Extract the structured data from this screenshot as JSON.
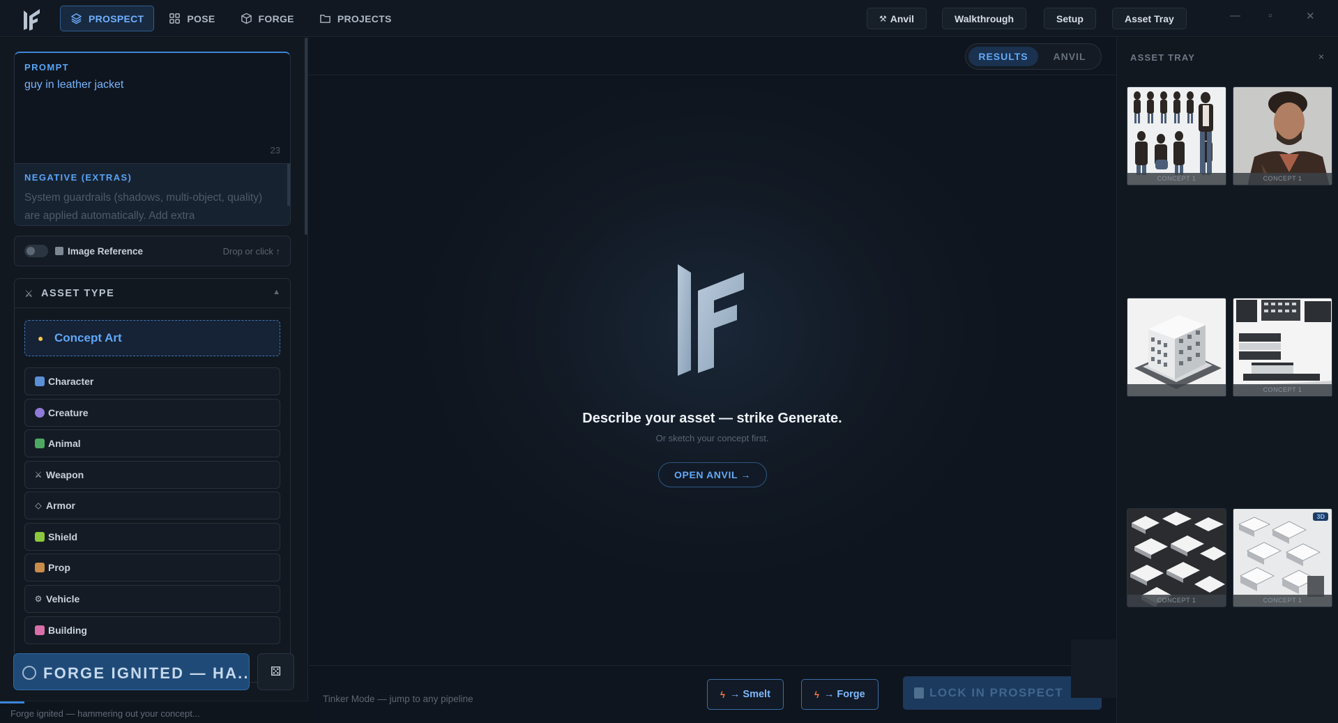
{
  "nav": {
    "tabs": [
      {
        "label": "PROSPECT",
        "icon": "layers-icon"
      },
      {
        "label": "POSE",
        "icon": "grid-icon"
      },
      {
        "label": "FORGE",
        "icon": "cube-icon"
      },
      {
        "label": "PROJECTS",
        "icon": "folder-icon"
      }
    ],
    "active": "PROSPECT"
  },
  "topbar": {
    "anvil_label": "Anvil",
    "walkthrough_label": "Walkthrough",
    "setup_label": "Setup",
    "asset_tray_label": "Asset Tray",
    "minimize": "—",
    "maximize": "▫",
    "close": "✕"
  },
  "prompt": {
    "label": "PROMPT",
    "value": "guy in leather jacket",
    "char_count": "23",
    "negative_label": "NEGATIVE (EXTRAS)",
    "negative_placeholder": "System guardrails (shadows, multi-object, quality) are applied automatically. Add extra"
  },
  "image_reference": {
    "label": "Image Reference",
    "hint": "Drop or click ↑",
    "enabled": false
  },
  "asset_type": {
    "title": "ASSET TYPE",
    "selected": {
      "label": "Concept Art",
      "icon": "lightbulb-icon"
    },
    "items": [
      {
        "label": "Character",
        "icon": "person-icon",
        "color": "#5b8fd6"
      },
      {
        "label": "Creature",
        "icon": "alien-icon",
        "color": "#8e7ad8"
      },
      {
        "label": "Animal",
        "icon": "dino-icon",
        "color": "#4ea862"
      },
      {
        "label": "Weapon",
        "icon": "swords-icon",
        "color": "#b6bfca"
      },
      {
        "label": "Armor",
        "icon": "shield-outline-icon",
        "color": "#b6bfca"
      },
      {
        "label": "Shield",
        "icon": "shield-icon",
        "color": "#8dc63f"
      },
      {
        "label": "Prop",
        "icon": "box-icon",
        "color": "#c98c4a"
      },
      {
        "label": "Vehicle",
        "icon": "gear-icon",
        "color": "#b6bfca"
      },
      {
        "label": "Building",
        "icon": "building-icon",
        "color": "#d86fa8"
      }
    ]
  },
  "forge_button": {
    "label": "FORGE IGNITED — HA..."
  },
  "dice_icon": "dice-icon",
  "status": {
    "text": "Forge ignited — hammering out your concept...",
    "progress": 0.08
  },
  "center": {
    "view_tabs": [
      "RESULTS",
      "ANVIL"
    ],
    "active_view": "RESULTS",
    "hero_title": "Describe your asset — strike Generate.",
    "hero_sub": "Or sketch your concept first.",
    "open_anvil_label": "OPEN ANVIL →",
    "tinker_text": "Tinker Mode — jump to any pipeline",
    "smelt_label": "→ Smelt",
    "forge_label": "→ Forge",
    "lock_label": "LOCK IN PROSPECT"
  },
  "tray": {
    "title": "ASSET TRAY",
    "close": "×",
    "items": [
      {
        "caption": "CONCEPT 1",
        "kind": "character-sheet"
      },
      {
        "caption": "CONCEPT 1",
        "kind": "portrait"
      },
      {
        "caption": "",
        "kind": "building"
      },
      {
        "caption": "CONCEPT 1",
        "kind": "building-sheet"
      },
      {
        "caption": "CONCEPT 1",
        "kind": "city-block"
      },
      {
        "caption": "CONCEPT 1",
        "kind": "city-block-3d",
        "badge": "3D"
      }
    ]
  }
}
